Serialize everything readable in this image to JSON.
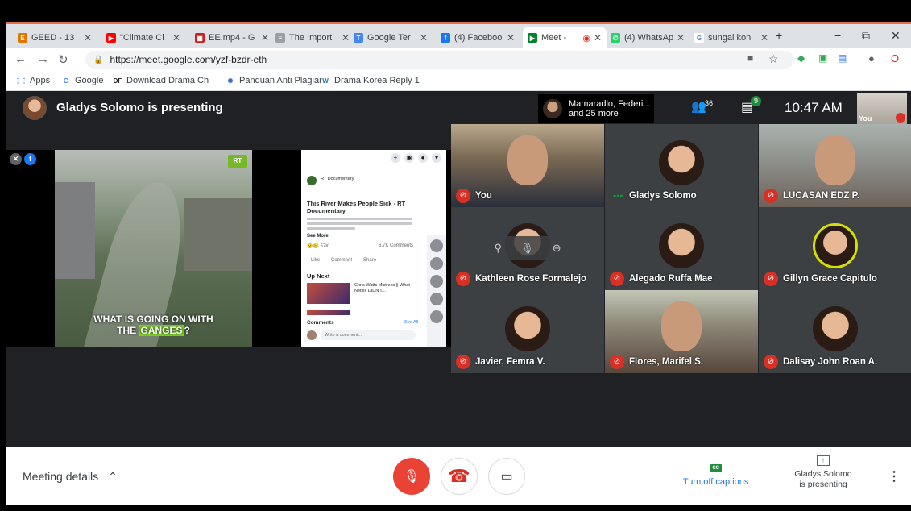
{
  "browser": {
    "tabs": [
      {
        "title": "GEED - 13",
        "fav_color": "#e37400",
        "fav_glyph": "E"
      },
      {
        "title": "\"Climate Cl",
        "fav_color": "#ff0000",
        "fav_glyph": "▶"
      },
      {
        "title": "EE.mp4 - G",
        "fav_color": "#c5221f",
        "fav_glyph": "▦"
      },
      {
        "title": "The Import",
        "fav_color": "#9aa0a6",
        "fav_glyph": "≡"
      },
      {
        "title": "Google Ter",
        "fav_color": "#4285f4",
        "fav_glyph": "T"
      },
      {
        "title": "(4) Faceboo",
        "fav_color": "#1877f2",
        "fav_glyph": "f"
      },
      {
        "title": "Meet -",
        "fav_color": "#00832d",
        "fav_glyph": "▶",
        "active": true
      },
      {
        "title": "(4) WhatsAp",
        "fav_color": "#25d366",
        "fav_glyph": "✆"
      },
      {
        "title": "sungai kon",
        "fav_color": "#ffffff",
        "fav_glyph": "G"
      }
    ],
    "new_tab": "+",
    "window_controls": {
      "minimize": "−",
      "restore": "⧉",
      "close": "✕"
    },
    "url": "https://meet.google.com/yzf-bzdr-eth",
    "bookmarks": [
      {
        "label": "Apps",
        "icon": "apps-grid-icon"
      },
      {
        "label": "Google",
        "icon": "google-icon"
      },
      {
        "label": "Download Drama Ch",
        "icon": "dramacool-icon"
      },
      {
        "label": "Panduan Anti Plagiar",
        "icon": "sunburst-icon"
      },
      {
        "label": "Drama Korea Reply 1",
        "icon": "wordpress-icon"
      }
    ]
  },
  "meet": {
    "presenting_text": "Gladys Solomo is presenting",
    "participants_chip": {
      "line1": "Mamaradlo, Federi...",
      "line2": "and 25 more"
    },
    "participant_count": "36",
    "chat_badge": "9",
    "time": "10:47 AM",
    "self_label": "You",
    "shared_video": {
      "caption_line1": "WHAT IS GOING ON WITH",
      "caption_line2_pre": "THE ",
      "caption_line2_hl": "GANGES",
      "caption_line2_post": "?",
      "logo": "RT"
    },
    "facebook_panel": {
      "page": "RT Documentary",
      "post_title": "This River Makes People Sick - RT Documentary",
      "see_more": "See More",
      "reactions": "57K",
      "comments_count": "6.7K Comments",
      "actions": [
        "Like",
        "Comment",
        "Share"
      ],
      "up_next": "Up Next",
      "up_next_item": "Chris Watts Mistress || What Netflix DIDN'T...",
      "comments_label": "Comments",
      "see_all": "See All",
      "write_placeholder": "Write a comment..."
    },
    "tiles": [
      {
        "name": "You",
        "type": "camera",
        "muted": true
      },
      {
        "name": "Gladys Solomo",
        "type": "avatar",
        "muted": false,
        "speaking": true
      },
      {
        "name": "LUCASAN EDZ P.",
        "type": "camera",
        "muted": true
      },
      {
        "name": "Kathleen Rose Formalejo",
        "type": "avatar",
        "muted": true
      },
      {
        "name": "Alegado Ruffa Mae",
        "type": "avatar",
        "muted": true
      },
      {
        "name": "Gillyn Grace Capitulo",
        "type": "avatar",
        "muted": true,
        "ring": true
      },
      {
        "name": "Javier, Femra V.",
        "type": "avatar",
        "muted": true
      },
      {
        "name": "Flores, Marifel S.",
        "type": "camera",
        "muted": true
      },
      {
        "name": "Dalisay John Roan A.",
        "type": "avatar",
        "muted": true
      }
    ],
    "bottom": {
      "meeting_details": "Meeting details",
      "captions_label": "Turn off captions",
      "presenting_line1": "Gladys Solomo",
      "presenting_line2": "is presenting"
    }
  },
  "colors": {
    "accent_red": "#ea4335",
    "meet_bg": "#202124",
    "captions_blue": "#1a73e8",
    "speaking_ring": "#d4e100"
  }
}
